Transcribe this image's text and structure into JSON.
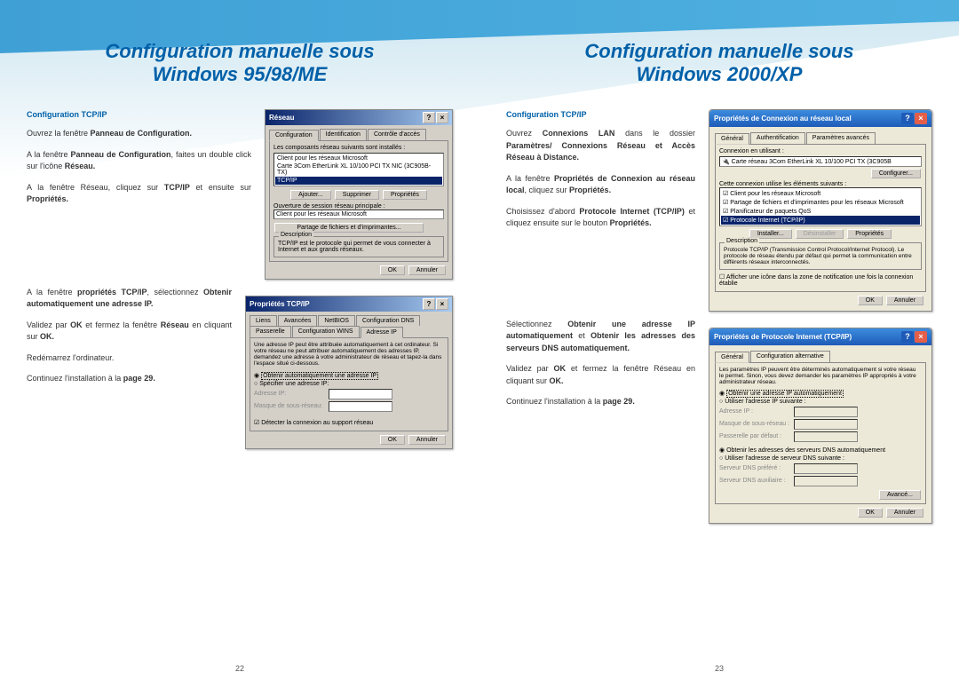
{
  "left": {
    "title_line1": "Configuration manuelle sous",
    "title_line2": "Windows 95/98/ME",
    "subhead": "Configuration TCP/IP",
    "p1_a": "Ouvrez la fenêtre ",
    "p1_b": "Panneau de Configuration.",
    "p2_a": "A la fenêtre ",
    "p2_b": "Panneau de Configuration",
    "p2_c": ", faites un double click sur l'icône ",
    "p2_d": "Réseau.",
    "p3_a": "A la fenêtre Réseau, cliquez sur ",
    "p3_b": "TCP/IP",
    "p3_c": " et ensuite sur ",
    "p3_d": "Propriétés.",
    "p4_a": "A la fenêtre ",
    "p4_b": "propriétés TCP/IP",
    "p4_c": ", sélectionnez ",
    "p4_d": "Obtenir automatiquement une adresse IP.",
    "p5_a": "Validez par ",
    "p5_b": "OK",
    "p5_c": " et fermez la fenêtre ",
    "p5_d": "Réseau",
    "p5_e": " en cliquant sur ",
    "p5_f": "OK.",
    "p6": "Redémarrez l'ordinateur.",
    "p7_a": "Continuez l'installation à la ",
    "p7_b": "page 29.",
    "page_num": "22",
    "ss1": {
      "title": "Réseau",
      "help": "?",
      "close": "×",
      "tab1": "Configuration",
      "tab2": "Identification",
      "tab3": "Contrôle d'accès",
      "label1": "Les composants réseau suivants sont installés :",
      "item1": "Client pour les réseaux Microsoft",
      "item2": "Carte 3Com EtherLink XL 10/100 PCI TX NIC (3C905B-TX)",
      "item3": "TCP/IP",
      "btn_add": "Ajouter...",
      "btn_del": "Supprimer",
      "btn_prop": "Propriétés",
      "label2": "Ouverture de session réseau principale :",
      "field2": "Client pour les réseaux Microsoft",
      "btn_share": "Partage de fichiers et d'imprimantes...",
      "desc_label": "Description",
      "desc_text": "TCP/IP est le protocole qui permet de vous connecter à Internet et aux grands réseaux.",
      "ok": "OK",
      "cancel": "Annuler"
    },
    "ss2": {
      "title": "Propriétés TCP/IP",
      "help": "?",
      "close": "×",
      "tab_r1_1": "Liens",
      "tab_r1_2": "Avancées",
      "tab_r1_3": "NetBIOS",
      "tab_r1_4": "Configuration DNS",
      "tab_r2_1": "Passerelle",
      "tab_r2_2": "Configuration WINS",
      "tab_r2_3": "Adresse IP",
      "desc": "Une adresse IP peut être attribuée automatiquement à cet ordinateur. Si votre réseau ne peut attribuer automatiquement des adresses IP, demandez une adresse à votre administrateur de réseau et tapez-la dans l'espace situé ci-dessous.",
      "radio1": "Obtenir automatiquement une adresse IP",
      "radio2": "Spécifier une adresse IP:",
      "ip_label": "Adresse IP:",
      "mask_label": "Masque de sous-réseau:",
      "check": "Détecter la connexion au support réseau",
      "ok": "OK",
      "cancel": "Annuler"
    }
  },
  "right": {
    "title_line1": "Configuration manuelle sous",
    "title_line2": "Windows 2000/XP",
    "subhead": "Configuration TCP/IP",
    "p1_a": "Ouvrez ",
    "p1_b": "Connexions LAN",
    "p1_c": " dans le dossier ",
    "p1_d": "Paramètres/ Connexions Réseau et Accès Réseau à Distance.",
    "p2_a": "A la fenêtre ",
    "p2_b": "Propriétés de Connexion au réseau local",
    "p2_c": ", cliquez sur ",
    "p2_d": "Propriétés.",
    "p3_a": "Choisissez d'abord ",
    "p3_b": "Protocole Internet (TCP/IP)",
    "p3_c": " et cliquez ensuite sur le bouton ",
    "p3_d": "Propriétés.",
    "p4_a": "Sélectionnez ",
    "p4_b": "Obtenir une adresse IP automatiquement",
    "p4_c": " et ",
    "p4_d": "Obtenir les adresses des serveurs DNS automatiquement.",
    "p5_a": "Validez par ",
    "p5_b": "OK",
    "p5_c": " et fermez la fenêtre Réseau en cliquant sur ",
    "p5_d": "OK.",
    "p6_a": "Continuez l'installation à la ",
    "p6_b": "page 29.",
    "page_num": "23",
    "ss3": {
      "title": "Propriétés de Connexion au réseau local",
      "help": "?",
      "close": "×",
      "tab1": "Général",
      "tab2": "Authentification",
      "tab3": "Paramètres avancés",
      "label1": "Connexion en utilisant :",
      "adapter": "Carte réseau 3Com EtherLink XL 10/100 PCI TX (3C905B",
      "btn_conf": "Configurer...",
      "label2": "Cette connexion utilise les éléments suivants :",
      "item1": "Client pour les réseaux Microsoft",
      "item2": "Partage de fichiers et d'imprimantes pour les réseaux Microsoft",
      "item3": "Planificateur de paquets QoS",
      "item4": "Protocole Internet (TCP/IP)",
      "btn_inst": "Installer...",
      "btn_uninst": "Désinstaller",
      "btn_prop": "Propriétés",
      "desc_label": "Description",
      "desc_text": "Protocole TCP/IP (Transmission Control Protocol/Internet Protocol). Le protocole de réseau étendu par défaut qui permet la communication entre différents réseaux interconnectés.",
      "check": "Afficher une icône dans la zone de notification une fois la connexion établie",
      "ok": "OK",
      "cancel": "Annuler"
    },
    "ss4": {
      "title": "Propriétés de Protocole Internet (TCP/IP)",
      "help": "?",
      "close": "×",
      "tab1": "Général",
      "tab2": "Configuration alternative",
      "desc": "Les paramètres IP peuvent être déterminés automatiquement si votre réseau le permet. Sinon, vous devez demander les paramètres IP appropriés à votre administrateur réseau.",
      "radio1": "Obtenir une adresse IP automatiquement",
      "radio2": "Utiliser l'adresse IP suivante :",
      "ip_label": "Adresse IP :",
      "mask_label": "Masque de sous-réseau :",
      "gw_label": "Passerelle par défaut :",
      "radio3": "Obtenir les adresses des serveurs DNS automatiquement",
      "radio4": "Utiliser l'adresse de serveur DNS suivante :",
      "dns1_label": "Serveur DNS préféré :",
      "dns2_label": "Serveur DNS auxiliaire :",
      "btn_adv": "Avancé...",
      "ok": "OK",
      "cancel": "Annuler"
    }
  }
}
